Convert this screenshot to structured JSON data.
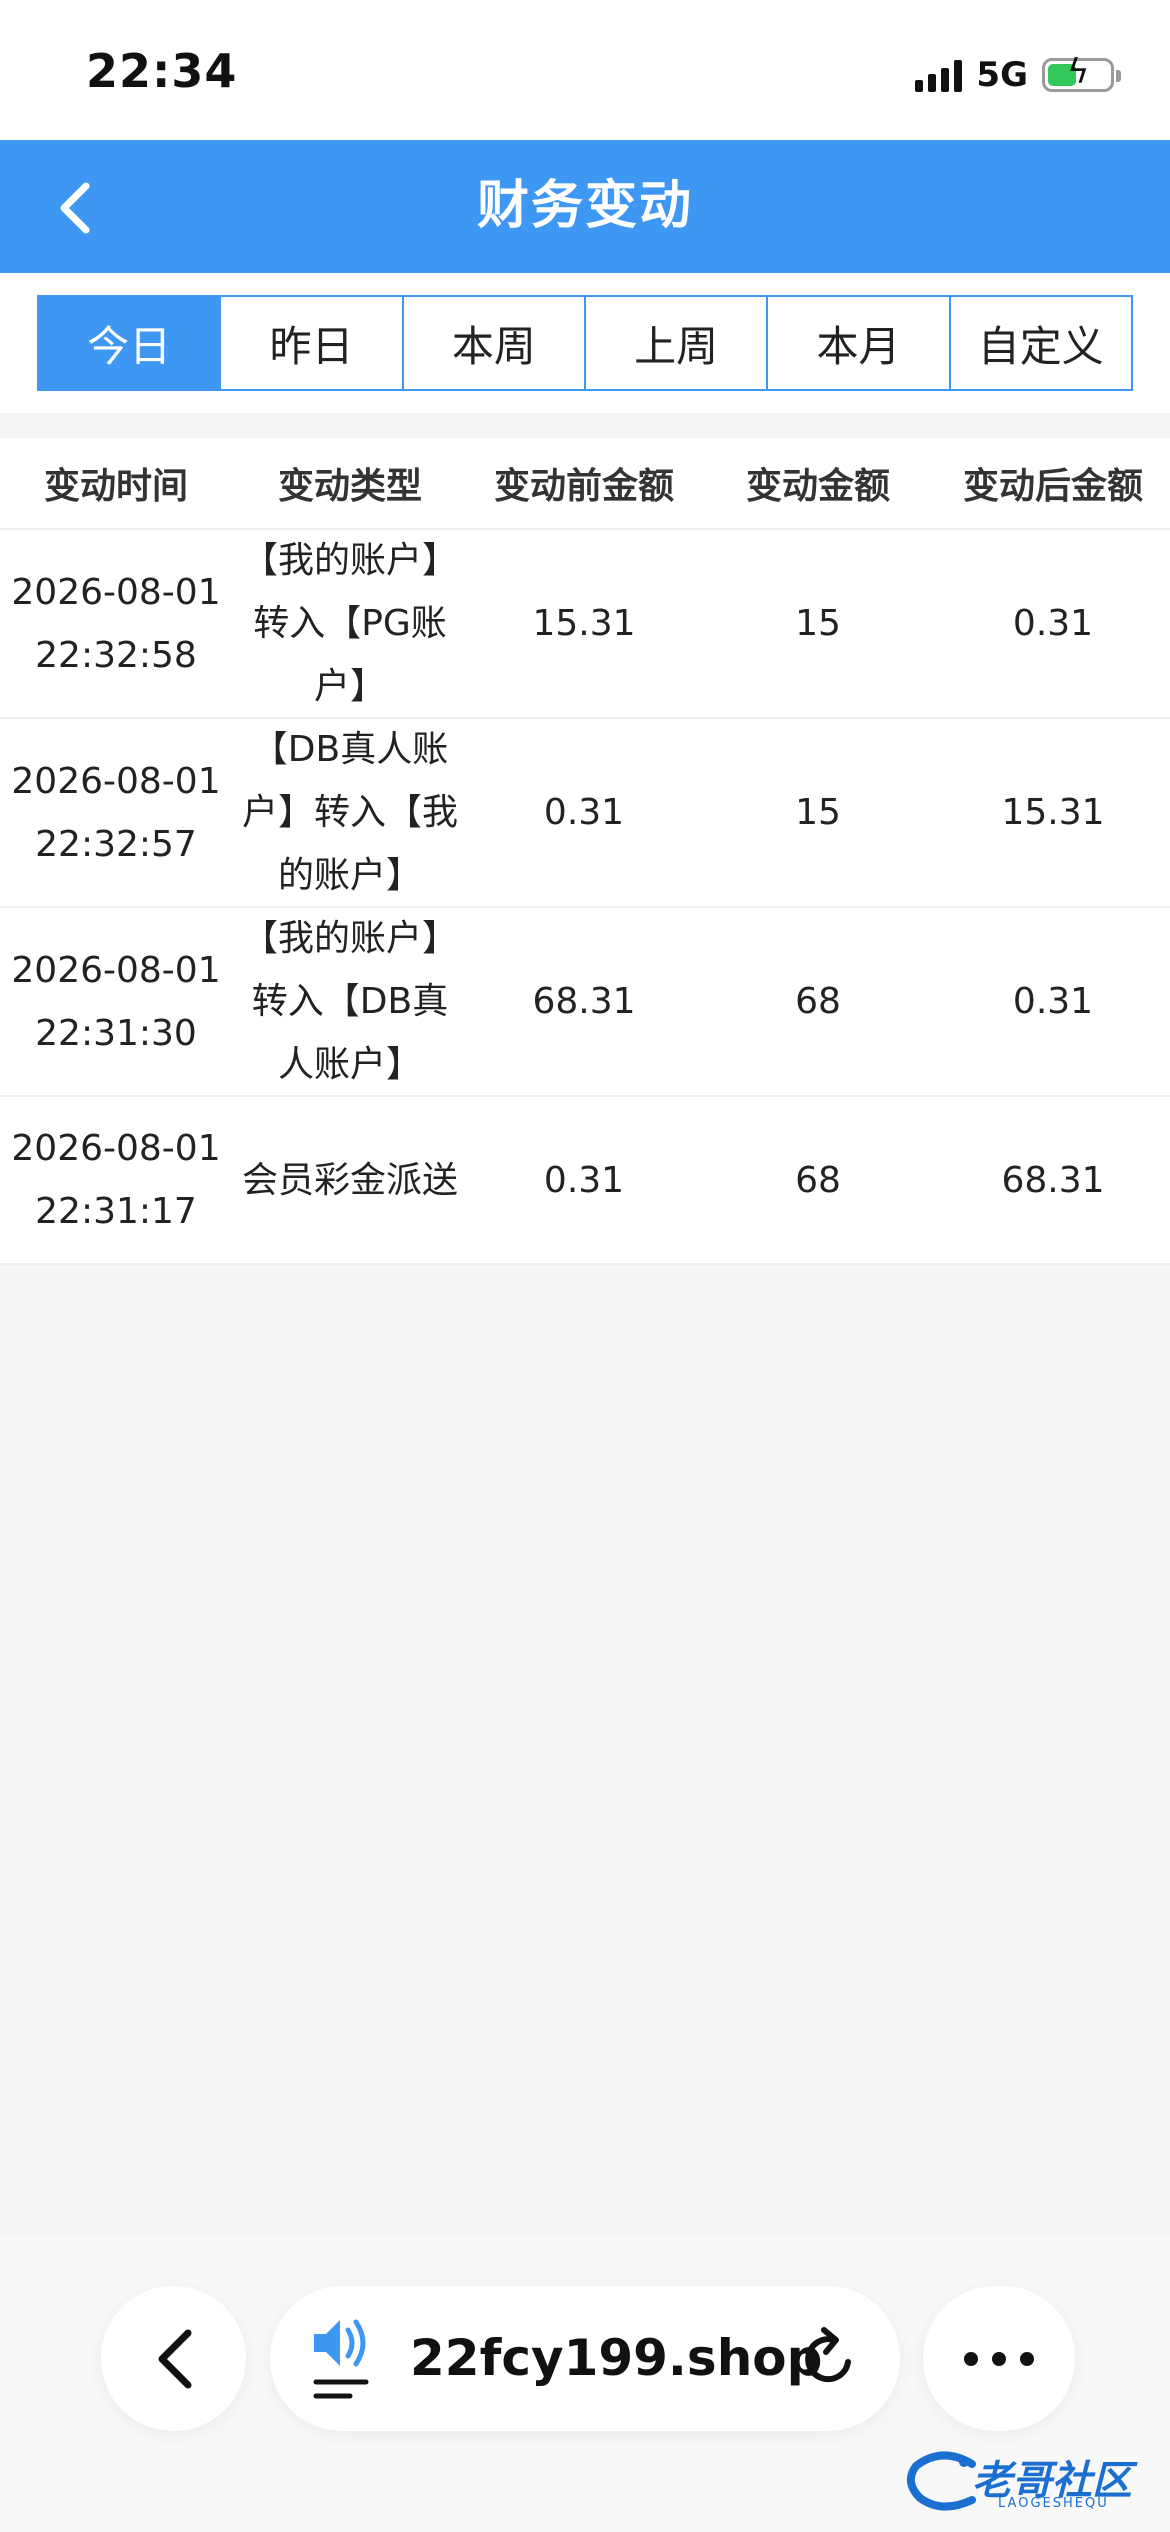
{
  "status_bar": {
    "time": "22:34",
    "network": "5G",
    "battery_level": 0.46
  },
  "header": {
    "title": "财务变动",
    "back_icon": "chevron-left-icon"
  },
  "tabs": [
    {
      "label": "今日",
      "active": true
    },
    {
      "label": "昨日",
      "active": false
    },
    {
      "label": "本周",
      "active": false
    },
    {
      "label": "上周",
      "active": false
    },
    {
      "label": "本月",
      "active": false
    },
    {
      "label": "自定义",
      "active": false
    }
  ],
  "table": {
    "columns": [
      "变动时间",
      "变动类型",
      "变动前金额",
      "变动金额",
      "变动后金额"
    ],
    "rows": [
      {
        "date": "2026-08-01",
        "time": "22:32:58",
        "type": "【我的账户】转入【PG账户】",
        "before": "15.31",
        "amount": "15",
        "after": "0.31"
      },
      {
        "date": "2026-08-01",
        "time": "22:32:57",
        "type": "【DB真人账户】转入【我的账户】",
        "before": "0.31",
        "amount": "15",
        "after": "15.31"
      },
      {
        "date": "2026-08-01",
        "time": "22:31:30",
        "type": "【我的账户】转入【DB真人账户】",
        "before": "68.31",
        "amount": "68",
        "after": "0.31"
      },
      {
        "date": "2026-08-01",
        "time": "22:31:17",
        "type": "会员彩金派送",
        "before": "0.31",
        "amount": "68",
        "after": "68.31"
      }
    ]
  },
  "browser_bar": {
    "url": "22fcy199.shop",
    "back_icon": "chevron-left-icon",
    "speaker_icon": "speaker-icon",
    "reload_icon": "reload-icon",
    "more_icon": "more-dots-icon"
  },
  "watermark": {
    "text": "老哥社区",
    "subtext": "LAOGESHEQU"
  },
  "colors": {
    "accent": "#3d97f3",
    "background": "#f4f5f7"
  }
}
